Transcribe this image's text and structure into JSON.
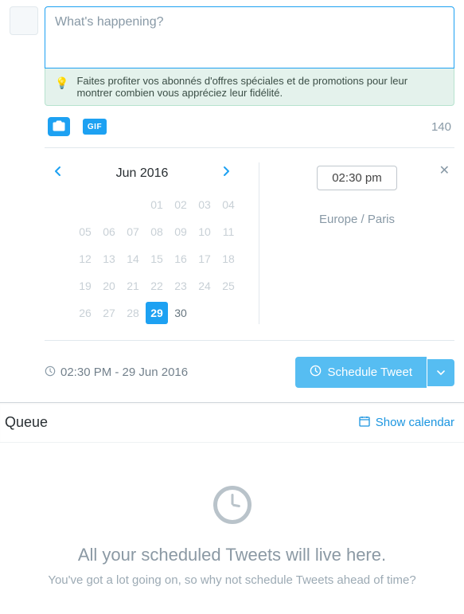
{
  "compose": {
    "placeholder": "What's happening?",
    "tip": "Faites profiter vos abonnés d'offres spéciales et de promotions pour leur montrer combien vous appréciez leur fidélité.",
    "char_count": "140",
    "gif_label": "GIF"
  },
  "calendar": {
    "title": "Jun 2016",
    "days": [
      {
        "n": "",
        "cls": "empty"
      },
      {
        "n": "",
        "cls": "empty"
      },
      {
        "n": "",
        "cls": "empty"
      },
      {
        "n": "01",
        "cls": ""
      },
      {
        "n": "02",
        "cls": ""
      },
      {
        "n": "03",
        "cls": ""
      },
      {
        "n": "04",
        "cls": ""
      },
      {
        "n": "05",
        "cls": ""
      },
      {
        "n": "06",
        "cls": ""
      },
      {
        "n": "07",
        "cls": ""
      },
      {
        "n": "08",
        "cls": ""
      },
      {
        "n": "09",
        "cls": ""
      },
      {
        "n": "10",
        "cls": ""
      },
      {
        "n": "11",
        "cls": ""
      },
      {
        "n": "12",
        "cls": ""
      },
      {
        "n": "13",
        "cls": ""
      },
      {
        "n": "14",
        "cls": ""
      },
      {
        "n": "15",
        "cls": ""
      },
      {
        "n": "16",
        "cls": ""
      },
      {
        "n": "17",
        "cls": ""
      },
      {
        "n": "18",
        "cls": ""
      },
      {
        "n": "19",
        "cls": ""
      },
      {
        "n": "20",
        "cls": ""
      },
      {
        "n": "21",
        "cls": ""
      },
      {
        "n": "22",
        "cls": ""
      },
      {
        "n": "23",
        "cls": ""
      },
      {
        "n": "24",
        "cls": ""
      },
      {
        "n": "25",
        "cls": ""
      },
      {
        "n": "26",
        "cls": ""
      },
      {
        "n": "27",
        "cls": ""
      },
      {
        "n": "28",
        "cls": ""
      },
      {
        "n": "29",
        "cls": "selected"
      },
      {
        "n": "30",
        "cls": "future"
      }
    ]
  },
  "time": {
    "value": "02:30 pm",
    "timezone": "Europe / Paris"
  },
  "schedule": {
    "summary": "02:30 PM - 29 Jun 2016",
    "button": "Schedule Tweet"
  },
  "queue": {
    "title": "Queue",
    "show_calendar": "Show calendar",
    "empty_title": "All your scheduled Tweets will live here.",
    "empty_sub": "You've got a lot going on, so why not schedule Tweets ahead of time?"
  }
}
